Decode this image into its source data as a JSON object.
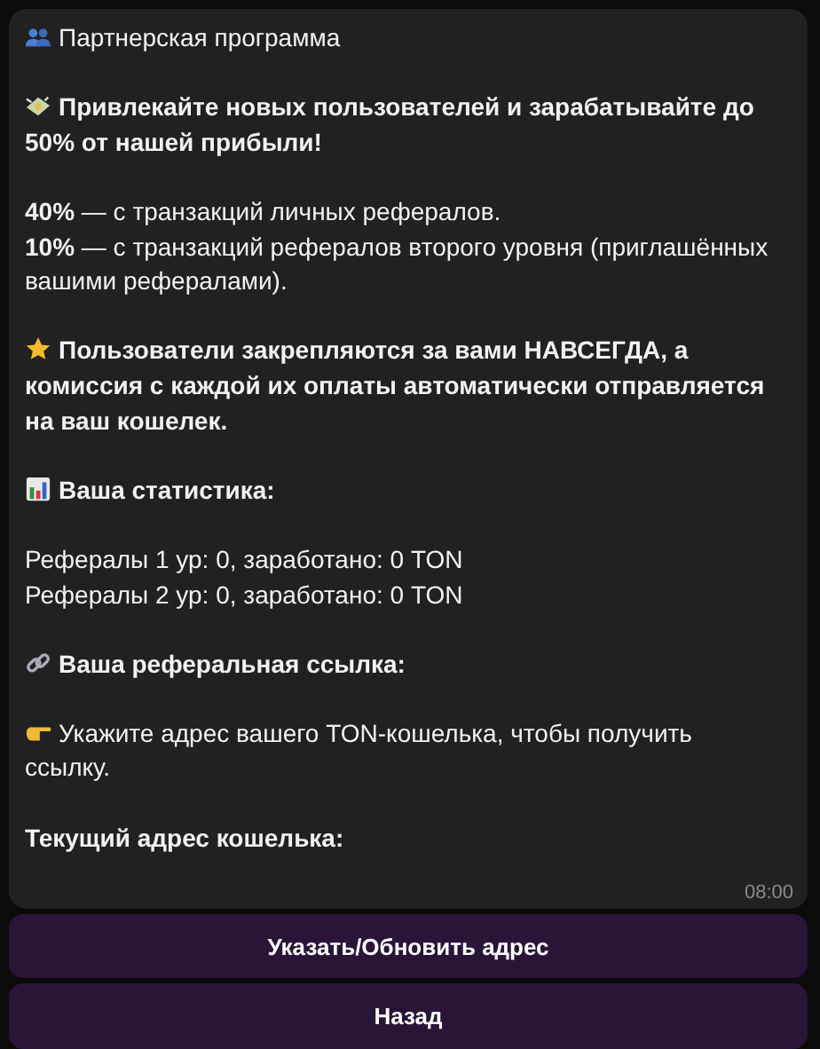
{
  "message": {
    "blocks": [
      {
        "kind": "text",
        "lines": [
          "Партнерская программа"
        ]
      },
      {
        "kind": "heading",
        "lines": [
          "Привлекайте новых пользователей и зарабатывайте до 50% от нашей прибыли!"
        ]
      },
      {
        "kind": "text",
        "lines": [
          "**40%** — с транзакций личных рефералов.",
          "**10%** — с транзакций рефералов второго уровня (приглашённых вашими рефералами)."
        ]
      },
      {
        "kind": "heading",
        "lines": [
          "Пользователи закрепляются за вами НАВСЕГДА, а комиссия с каждой их оплаты автоматически отправляется на ваш кошелек."
        ]
      },
      {
        "kind": "heading",
        "lines": [
          "Ваша статистика:"
        ]
      },
      {
        "kind": "text",
        "lines": [
          "Рефералы 1 ур: 0, заработано: 0 TON",
          "Рефералы 2 ур: 0, заработано: 0 TON"
        ]
      },
      {
        "kind": "heading",
        "lines": [
          "Ваша реферальная ссылка:"
        ]
      },
      {
        "kind": "text",
        "lines": [
          "Укажите адрес вашего TON-кошелька, чтобы получить ссылку."
        ]
      },
      {
        "kind": "heading",
        "lines": [
          "Текущий адрес кошелька:"
        ]
      }
    ],
    "time": "08:00"
  },
  "buttons": [
    "Указать/Обновить адрес",
    "Назад"
  ]
}
